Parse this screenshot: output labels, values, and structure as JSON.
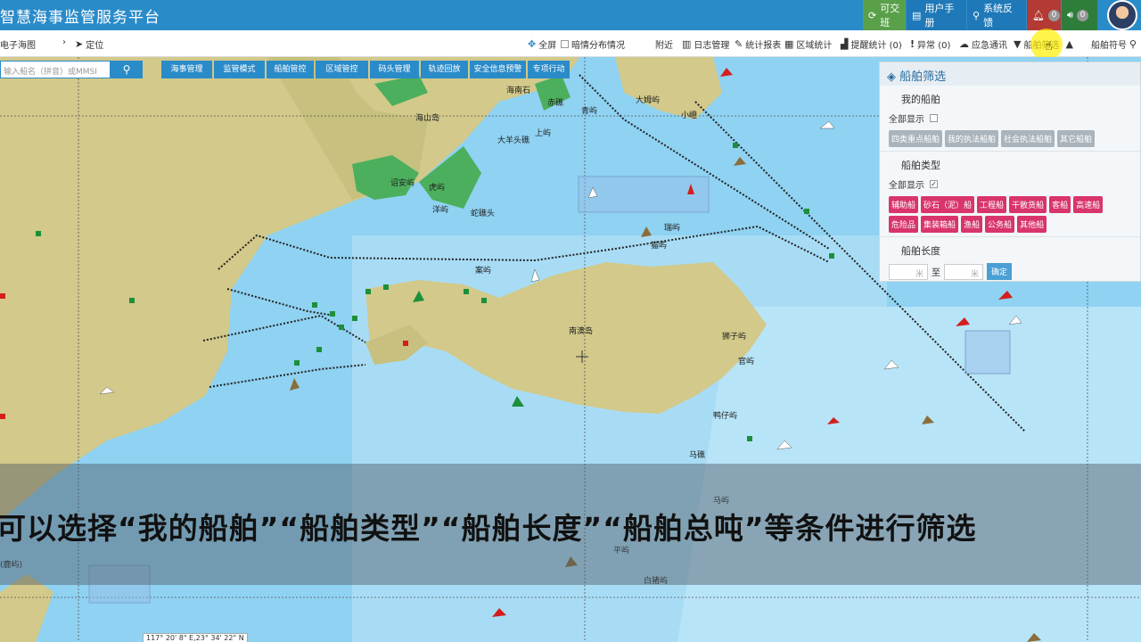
{
  "app": {
    "title": "智慧海事监管服务平台"
  },
  "header": {
    "buttons": [
      {
        "label": "可交班",
        "icon": "refresh-icon"
      },
      {
        "label": "用户手册",
        "icon": "book-icon"
      },
      {
        "label": "系统反馈",
        "icon": "location-icon"
      }
    ],
    "bell_count": "0",
    "sound_count": "0"
  },
  "toolbar": {
    "left": {
      "chart": "电子海图",
      "locate": "定位"
    },
    "fullscreen": "全屏",
    "weather": "暗情分布情况",
    "nearby": "附近",
    "log": "日志管理",
    "stats_report": "统计报表",
    "area_stats": "区域统计",
    "alert_stats": "提醒统计 (0)",
    "abnormal": "异常 (0)",
    "emergency": "应急通讯",
    "ship_filter": "船舶筛选",
    "ship_symbol": "船舶符号"
  },
  "search": {
    "placeholder": "输入船名（拼音）或MMSI"
  },
  "nav_tabs": [
    "海事管理",
    "监管模式",
    "船舶管控",
    "区域管控",
    "码头管理",
    "轨迹回放",
    "安全信息预警",
    "专项行动"
  ],
  "filter_panel": {
    "title": "船舶筛选",
    "my_ships": {
      "title": "我的船舶",
      "show_all": "全部显示",
      "tags": [
        "四类重点船舶",
        "我的执法船舶",
        "社会执法船舶",
        "其它船舶"
      ]
    },
    "ship_types": {
      "title": "船舶类型",
      "show_all": "全部显示",
      "tags": [
        "辅助船",
        "砂石（泥）船",
        "工程船",
        "干散货船",
        "客船",
        "高速船",
        "危险品",
        "集装箱船",
        "渔船",
        "公务船",
        "其他船"
      ]
    },
    "ship_length": {
      "title": "船舶长度",
      "unit": "米",
      "to": "至",
      "confirm": "确定"
    }
  },
  "map_labels": [
    "海南石",
    "赤礁",
    "青屿",
    "大姆屿",
    "小嶝",
    "海山岛",
    "上屿",
    "大羊头礁",
    "诏安屿",
    "虎屿",
    "洋屿",
    "蛇礁头",
    "猫屿",
    "瑞屿",
    "案屿",
    "南澳岛",
    "狮子屿",
    "官屿",
    "鸭仔屿",
    "马礁",
    "马屿",
    "平屿",
    "白猪屿",
    "(鹿屿)"
  ],
  "coord_readout": "117° 20' 8\" E,23° 34' 22\" N",
  "subtitle": "可以选择“我的船舶”“船舶类型”“船舶长度”“船舶总吨”等条件进行筛选"
}
